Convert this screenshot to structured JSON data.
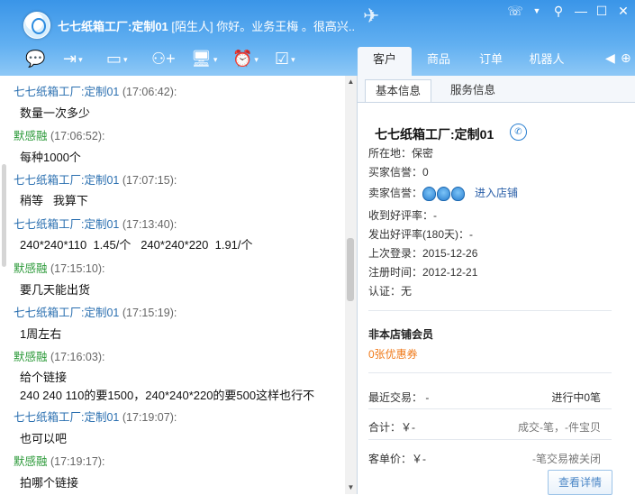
{
  "header": {
    "title_name": "七七纸箱工厂:定制01",
    "title_rest": " [陌生人] 你好。业务王梅 。很高兴..."
  },
  "right_tabs": [
    "客户",
    "商品",
    "订单",
    "机器人"
  ],
  "messages": [
    {
      "sender": "七七纸箱工厂:定制01",
      "time": "(17:06:42):",
      "text": "数量一次多少",
      "self": false
    },
    {
      "sender": "默感融",
      "time": "(17:06:52):",
      "text": "每种1000个",
      "self": true
    },
    {
      "sender": "七七纸箱工厂:定制01",
      "time": "(17:07:15):",
      "text": "稍等   我算下",
      "self": false
    },
    {
      "sender": "七七纸箱工厂:定制01",
      "time": "(17:13:40):",
      "text": "240*240*110  1.45/个   240*240*220  1.91/个",
      "self": false
    },
    {
      "sender": "默感融",
      "time": "(17:15:10):",
      "text": "要几天能出货",
      "self": true
    },
    {
      "sender": "七七纸箱工厂:定制01",
      "time": "(17:15:19):",
      "text": "1周左右",
      "self": false
    },
    {
      "sender": "默感融",
      "time": "(17:16:03):",
      "text": "给个链接",
      "text2": "240 240 110的要1500，240*240*220的要500这样也行不",
      "self": true
    },
    {
      "sender": "七七纸箱工厂:定制01",
      "time": "(17:19:07):",
      "text": "也可以吧",
      "self": false
    },
    {
      "sender": "默感融",
      "time": "(17:19:17):",
      "text": "拍哪个链接",
      "self": true
    }
  ],
  "panel": {
    "tab_basic": "基本信息",
    "tab_service": "服务信息",
    "shop_name": "七七纸箱工厂:定制01",
    "location": "所在地：保密",
    "buyer_credit": "买家信誉：0",
    "seller_credit": "卖家信誉：",
    "enter_shop": "进入店铺",
    "good_rate_received": "收到好评率：-",
    "good_rate_given": "发出好评率(180天)：-",
    "last_login": "上次登录：2015-12-26",
    "register_time": "注册时间：2012-12-21",
    "verify": "认证：无",
    "member": "非本店铺会员",
    "coupon": "0张优惠券",
    "recent_trade": "最近交易：  -",
    "in_progress": "进行中0笔",
    "total": "合计：￥-",
    "deal_summary": "成交-笔，-件宝贝",
    "unit_price": "客单价：￥-",
    "closed": "-笔交易被关闭",
    "detail_button": "查看详情"
  }
}
